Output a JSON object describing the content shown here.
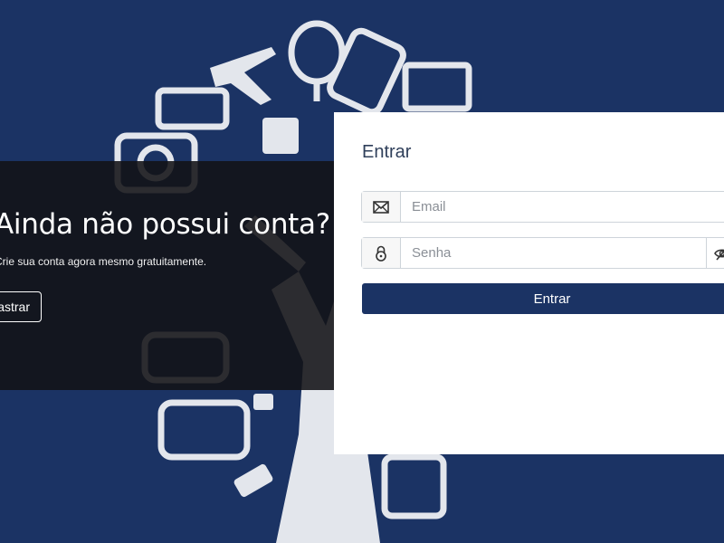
{
  "promo": {
    "title": "Ainda não possui conta?",
    "subtitle": "Crie sua conta agora mesmo gratuitamente.",
    "register_button": "Cadastrar"
  },
  "login": {
    "title": "Entrar",
    "email_placeholder": "Email",
    "email_icon": "envelope-icon",
    "password_placeholder": "Senha",
    "password_icon": "lock-icon",
    "toggle_icon": "eye-slash-icon",
    "submit_label": "Entrar"
  },
  "colors": {
    "background": "#1b3364",
    "primary_button": "#1b3364",
    "card": "#ffffff",
    "promo_panel": "#121216"
  }
}
